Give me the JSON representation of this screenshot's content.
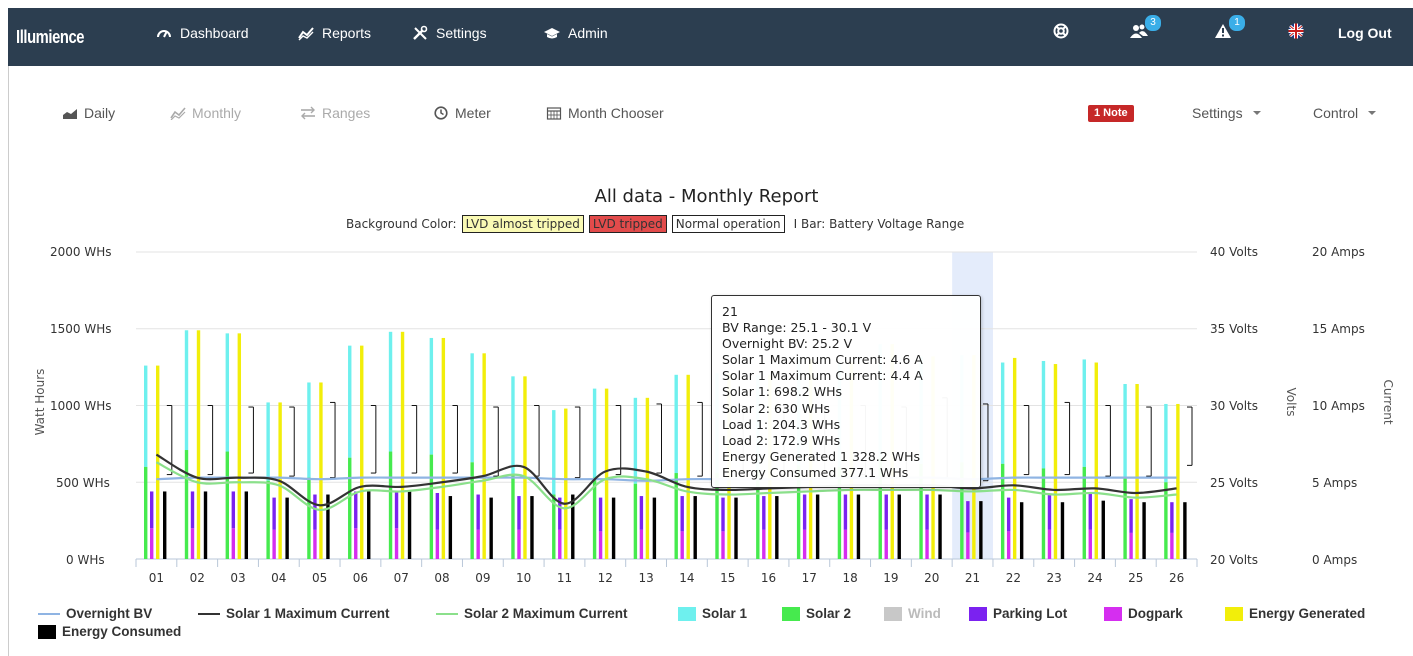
{
  "brand": "Illumience",
  "nav": {
    "items": [
      {
        "label": "Dashboard",
        "icon": "dashboard-icon"
      },
      {
        "label": "Reports",
        "icon": "chart-line-icon"
      },
      {
        "label": "Settings",
        "icon": "tools-icon"
      },
      {
        "label": "Admin",
        "icon": "graduation-cap-icon"
      }
    ],
    "users_badge": "3",
    "alerts_badge": "1",
    "logout": "Log Out"
  },
  "subnav": {
    "daily": "Daily",
    "monthly": "Monthly",
    "ranges": "Ranges",
    "meter": "Meter",
    "month_chooser": "Month Chooser",
    "note_badge": "1 Note",
    "settings": "Settings",
    "control": "Control"
  },
  "background_legend": {
    "prefix": "Background Color:",
    "almost": "LVD almost tripped",
    "tripped": "LVD tripped",
    "normal": "Normal operation",
    "ibar": "I Bar: Battery Voltage Range"
  },
  "tooltip": {
    "lines": [
      "21",
      "BV Range: 25.1 - 30.1 V",
      "Overnight BV: 25.2 V",
      "Solar 1 Maximum Current: 4.6 A",
      "Solar 1 Maximum Current: 4.4 A",
      "Solar 1: 698.2 WHs",
      "Solar 2: 630 WHs",
      "Load 1: 204.3 WHs",
      "Load 2: 172.9 WHs",
      "Energy Generated 1 328.2 WHs",
      "Energy Consumed 377.1 WHs"
    ]
  },
  "chart_data": {
    "type": "bar",
    "title": "All data - Monthly Report",
    "categories": [
      "01",
      "02",
      "03",
      "04",
      "05",
      "06",
      "07",
      "08",
      "09",
      "10",
      "11",
      "12",
      "13",
      "14",
      "15",
      "16",
      "17",
      "18",
      "19",
      "20",
      "21",
      "22",
      "23",
      "24",
      "25",
      "26"
    ],
    "y_left": {
      "label": "Watt Hours",
      "ticks": [
        "2000 WHs",
        "1500 WHs",
        "1000 WHs",
        "500 WHs",
        "0 WHs"
      ],
      "range": [
        0,
        2000
      ]
    },
    "y_volts": {
      "label": "Volts",
      "ticks": [
        "40 Volts",
        "35 Volts",
        "30 Volts",
        "25 Volts",
        "20 Volts"
      ],
      "range": [
        20,
        40
      ]
    },
    "y_amps": {
      "label": "Current",
      "ticks": [
        "20 Amps",
        "15 Amps",
        "10 Amps",
        "5 Amps",
        "0 Amps"
      ],
      "range": [
        0,
        20
      ]
    },
    "highlight_category": "21",
    "series": [
      {
        "name": "Solar 1",
        "color": "#6ef0ee",
        "values": [
          660,
          780,
          770,
          510,
          620,
          730,
          780,
          760,
          710,
          640,
          550,
          580,
          560,
          640,
          650,
          620,
          690,
          680,
          740,
          700,
          698,
          660,
          700,
          700,
          610,
          510
        ]
      },
      {
        "name": "Solar 2",
        "color": "#46ea4e",
        "values": [
          600,
          710,
          700,
          510,
          530,
          660,
          700,
          680,
          630,
          550,
          420,
          530,
          490,
          560,
          560,
          580,
          610,
          600,
          660,
          620,
          630,
          620,
          590,
          600,
          530,
          500
        ]
      },
      {
        "name": "Wind",
        "color": "#c8c8c8",
        "values": []
      },
      {
        "name": "Parking Lot",
        "color": "#7b22f0",
        "values": [
          240,
          240,
          240,
          210,
          230,
          240,
          240,
          240,
          230,
          220,
          210,
          220,
          220,
          230,
          220,
          220,
          230,
          230,
          230,
          230,
          204,
          220,
          230,
          240,
          220,
          200
        ]
      },
      {
        "name": "Dogpark",
        "color": "#d52ef0",
        "values": [
          200,
          200,
          200,
          190,
          190,
          200,
          200,
          190,
          190,
          190,
          190,
          180,
          190,
          180,
          180,
          190,
          190,
          190,
          190,
          190,
          173,
          180,
          190,
          190,
          170,
          170
        ]
      },
      {
        "name": "Energy Generated",
        "color": "#f2ee0a",
        "values": [
          1260,
          1490,
          1470,
          1020,
          1150,
          1390,
          1480,
          1440,
          1340,
          1190,
          980,
          1110,
          1050,
          1200,
          1210,
          1200,
          1300,
          1280,
          1400,
          1320,
          1328,
          1310,
          1270,
          1280,
          1140,
          1010
        ]
      },
      {
        "name": "Energy Consumed",
        "color": "#000000",
        "values": [
          440,
          440,
          440,
          400,
          420,
          440,
          440,
          410,
          400,
          410,
          420,
          400,
          400,
          410,
          400,
          410,
          420,
          420,
          420,
          420,
          377,
          370,
          370,
          380,
          370,
          370
        ]
      }
    ],
    "lines": [
      {
        "name": "Overnight BV",
        "color": "#8fb4e3",
        "axis": "volts",
        "values": [
          25.2,
          25.3,
          25.3,
          25.3,
          25.2,
          25.3,
          25.3,
          25.3,
          25.3,
          25.3,
          25.2,
          25.2,
          25.1,
          25.2,
          25.2,
          25.2,
          25.2,
          25.3,
          25.3,
          25.3,
          25.2,
          25.3,
          25.3,
          25.3,
          25.3,
          25.3
        ]
      },
      {
        "name": "Solar 1 Maximum Current",
        "color": "#333333",
        "axis": "amps",
        "values": [
          6.8,
          5.3,
          5.3,
          5.1,
          3.5,
          4.7,
          4.7,
          5.0,
          5.4,
          6.0,
          3.6,
          5.7,
          5.7,
          4.7,
          4.5,
          4.6,
          4.7,
          4.8,
          4.8,
          4.8,
          4.6,
          4.8,
          4.5,
          4.6,
          4.3,
          4.6
        ]
      },
      {
        "name": "Solar 2 Maximum Current",
        "color": "#8be08b",
        "axis": "amps",
        "values": [
          6.3,
          5.0,
          5.0,
          4.8,
          3.2,
          4.4,
          4.4,
          4.7,
          5.1,
          5.4,
          3.3,
          5.2,
          5.2,
          4.4,
          4.2,
          4.3,
          4.4,
          4.5,
          4.5,
          4.5,
          4.4,
          4.5,
          4.2,
          4.3,
          4.0,
          4.2
        ]
      }
    ],
    "bv_range": [
      [
        25.5,
        30.0
      ],
      [
        25.5,
        30.0
      ],
      [
        25.6,
        29.9
      ],
      [
        25.4,
        29.9
      ],
      [
        25.3,
        30.2
      ],
      [
        25.6,
        30.0
      ],
      [
        25.6,
        30.0
      ],
      [
        25.6,
        30.0
      ],
      [
        25.4,
        29.9
      ],
      [
        25.4,
        30.0
      ],
      [
        25.3,
        29.9
      ],
      [
        25.5,
        30.0
      ],
      [
        25.6,
        30.1
      ],
      [
        25.4,
        30.2
      ],
      [
        25.5,
        30.0
      ],
      [
        25.5,
        30.0
      ],
      [
        25.5,
        30.0
      ],
      [
        25.5,
        30.0
      ],
      [
        25.3,
        29.9
      ],
      [
        25.3,
        30.5
      ],
      [
        25.1,
        30.1
      ],
      [
        25.5,
        30.0
      ],
      [
        25.5,
        30.2
      ],
      [
        25.4,
        30.0
      ],
      [
        25.4,
        29.9
      ],
      [
        26.1,
        29.9
      ]
    ]
  },
  "legend": [
    {
      "label": "Overnight BV",
      "color": "#8fb4e3",
      "kind": "line"
    },
    {
      "label": "Solar 1 Maximum Current",
      "color": "#333333",
      "kind": "line"
    },
    {
      "label": "Solar 2 Maximum Current",
      "color": "#8be08b",
      "kind": "line"
    },
    {
      "label": "Solar 1",
      "color": "#6ef0ee",
      "kind": "box"
    },
    {
      "label": "Solar 2",
      "color": "#46ea4e",
      "kind": "box"
    },
    {
      "label": "Wind",
      "color": "#c8c8c8",
      "kind": "box",
      "disabled": true
    },
    {
      "label": "Parking Lot",
      "color": "#7b22f0",
      "kind": "box"
    },
    {
      "label": "Dogpark",
      "color": "#d52ef0",
      "kind": "box"
    },
    {
      "label": "Energy Generated",
      "color": "#f2ee0a",
      "kind": "box"
    },
    {
      "label": "Energy Consumed",
      "color": "#000000",
      "kind": "box"
    }
  ]
}
